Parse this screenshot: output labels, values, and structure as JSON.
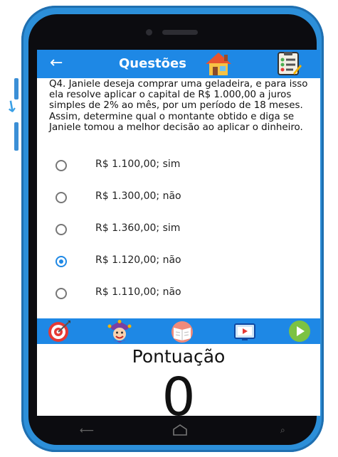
{
  "app": {
    "title": "Questões",
    "icons": {
      "back": "arrow-left-icon",
      "home": "home-icon",
      "list": "checklist-icon"
    }
  },
  "question": {
    "text": "Q4. Janiele deseja comprar uma geladeira, e para isso ela resolve aplicar o capital de R$ 1.000,00 a juros simples de 2% ao mês, por um período de 18 meses. Assim, determine qual o montante obtido e diga se Janiele tomou a melhor decisão ao aplicar o dinheiro."
  },
  "options": [
    {
      "label": "R$ 1.100,00; sim",
      "selected": false
    },
    {
      "label": "R$ 1.300,00; não",
      "selected": false
    },
    {
      "label": "R$ 1.360,00; sim",
      "selected": false
    },
    {
      "label": "R$ 1.120,00; não",
      "selected": true
    },
    {
      "label": "R$ 1.110,00; não",
      "selected": false
    }
  ],
  "toolbar": {
    "icons": [
      "target-icon",
      "jester-icon",
      "book-icon",
      "video-icon",
      "play-icon"
    ]
  },
  "score": {
    "label": "Pontuação",
    "value": "0"
  },
  "colors": {
    "primary": "#1e88e5",
    "phone_body": "#2c8fd9",
    "play": "#7cc242"
  }
}
